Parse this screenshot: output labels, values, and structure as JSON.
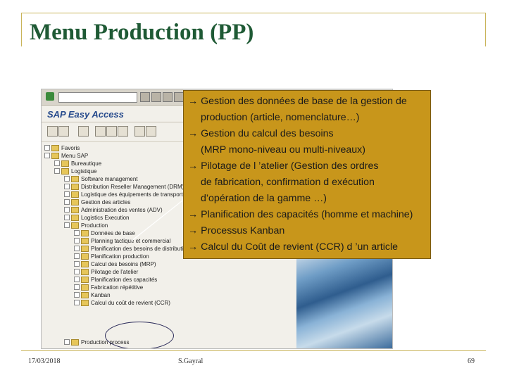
{
  "slide": {
    "title": "Menu Production (PP)",
    "footer": {
      "date": "17/03/2018",
      "author": "S.Gayral",
      "page": "69"
    }
  },
  "sap": {
    "title": "SAP Easy Access",
    "tree": [
      {
        "label": "Favoris"
      },
      {
        "label": "Menu SAP"
      },
      {
        "label": "Bureautique"
      },
      {
        "label": "Logistique"
      },
      {
        "label": "Software management"
      },
      {
        "label": "Distribution Reseller Management (DRM)"
      },
      {
        "label": "Logistique des équipements de transport"
      },
      {
        "label": "Gestion des articles"
      },
      {
        "label": "Administration des ventes (ADV)"
      },
      {
        "label": "Logistics Execution"
      },
      {
        "label": "Production"
      },
      {
        "label": "Données de base"
      },
      {
        "label": "Planning tactique et commercial"
      },
      {
        "label": "Planification des besoins de distribution"
      },
      {
        "label": "Planification production"
      },
      {
        "label": "Calcul des besoins (MRP)"
      },
      {
        "label": "Pilotage de l'atelier"
      },
      {
        "label": "Planification des capacités"
      },
      {
        "label": "Fabrication répétitive"
      },
      {
        "label": "Kanban"
      },
      {
        "label": "Calcul du coût de revient (CCR)"
      },
      {
        "label": "Production process"
      }
    ]
  },
  "callout": {
    "lines": [
      {
        "text": "→ Gestion des données de base de la gestion de",
        "kind": "main"
      },
      {
        "text": "production (article, nomenclature…)",
        "kind": "sub"
      },
      {
        "text": "→ Gestion du calcul des besoins",
        "kind": "main"
      },
      {
        "text": "(MRP mono-niveau ou multi-niveaux)",
        "kind": "sub"
      },
      {
        "text": "→ Pilotage de l ’atelier (Gestion des ordres",
        "kind": "main"
      },
      {
        "text": "de fabrication, confirmation d exécution",
        "kind": "sub"
      },
      {
        "text": "d’opération de la gamme …)",
        "kind": "sub"
      },
      {
        "text": "→ Planification des capacités (homme et machine)",
        "kind": "main"
      },
      {
        "text": "→ Processus Kanban",
        "kind": "main"
      },
      {
        "text": "→ Calcul du Coût de revient (CCR) d ’un article",
        "kind": "main"
      }
    ]
  }
}
